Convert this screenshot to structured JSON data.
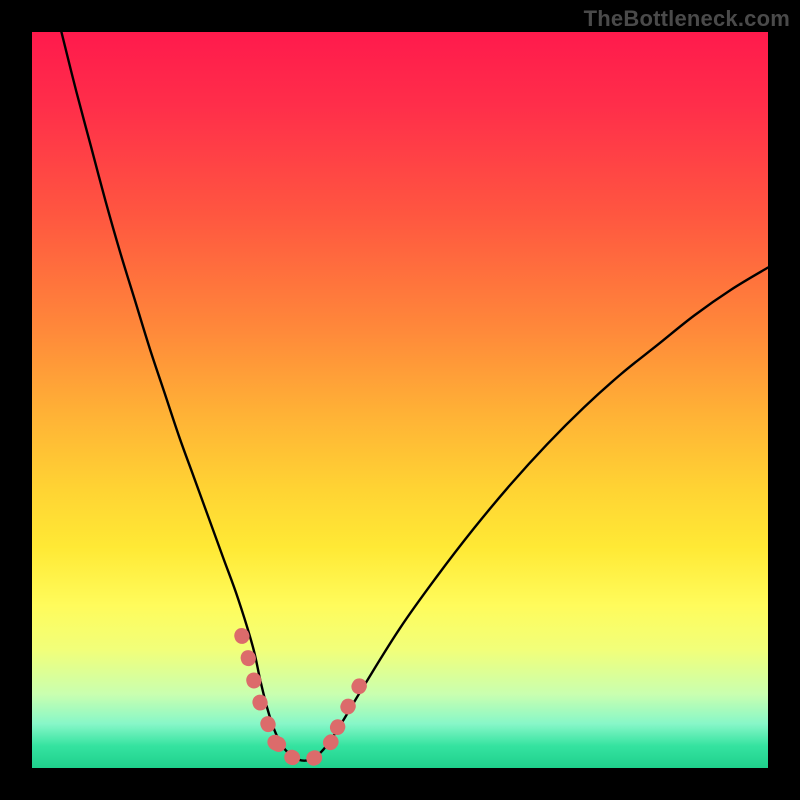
{
  "watermark": "TheBottleneck.com",
  "chart_data": {
    "type": "line",
    "title": "",
    "xlabel": "",
    "ylabel": "",
    "xlim": [
      0,
      100
    ],
    "ylim": [
      0,
      100
    ],
    "legend": false,
    "grid": false,
    "annotations": [],
    "series": [
      {
        "name": "bottleneck-curve",
        "x": [
          4,
          6,
          8,
          10,
          12,
          14,
          16,
          18,
          20,
          22,
          24,
          26,
          28,
          30,
          31,
          32,
          33,
          34,
          35.5,
          37,
          38.5,
          40,
          42,
          45,
          50,
          55,
          60,
          65,
          70,
          75,
          80,
          85,
          90,
          95,
          100
        ],
        "values": [
          100,
          92,
          84.5,
          77,
          70,
          63.5,
          57,
          51,
          45,
          39.5,
          34,
          28.5,
          23,
          16.5,
          12,
          8,
          5,
          3,
          1.5,
          1,
          1.5,
          3,
          6,
          11,
          19,
          26,
          32.5,
          38.5,
          44,
          49,
          53.5,
          57.5,
          61.5,
          65,
          68
        ]
      },
      {
        "name": "highlight-left",
        "x": [
          28.5,
          29.5,
          30.5,
          31.5,
          32.5,
          33.5
        ],
        "values": [
          18,
          14.5,
          10.5,
          7.4,
          5.0,
          3.2
        ]
      },
      {
        "name": "highlight-bottom",
        "x": [
          33,
          34,
          35,
          36,
          37,
          38,
          39,
          40,
          41
        ],
        "values": [
          3.5,
          2.2,
          1.6,
          1.2,
          1.0,
          1.2,
          1.8,
          2.8,
          4.0
        ]
      },
      {
        "name": "highlight-right",
        "x": [
          41.5,
          42.5,
          43.5,
          44.5
        ],
        "values": [
          5.5,
          7.5,
          9.4,
          11.2
        ]
      }
    ],
    "colors": {
      "curve": "#000000",
      "highlight": "#dc6b6b",
      "background_top": "#ff1a4c",
      "background_bottom": "#1fd08c"
    }
  }
}
